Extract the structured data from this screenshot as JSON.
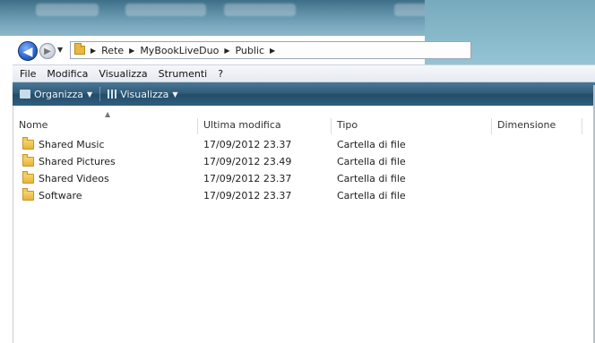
{
  "breadcrumb": [
    "Rete",
    "MyBookLiveDuo",
    "Public"
  ],
  "menu": [
    "File",
    "Modifica",
    "Visualizza",
    "Strumenti",
    "?"
  ],
  "toolbar": {
    "organize": "Organizza",
    "view": "Visualizza"
  },
  "columns": {
    "name": "Nome",
    "modified": "Ultima modifica",
    "type": "Tipo",
    "size": "Dimensione"
  },
  "files": [
    {
      "name": "Shared Music",
      "modified": "17/09/2012 23.37",
      "type": "Cartella di file"
    },
    {
      "name": "Shared Pictures",
      "modified": "17/09/2012 23.49",
      "type": "Cartella di file"
    },
    {
      "name": "Shared Videos",
      "modified": "17/09/2012 23.37",
      "type": "Cartella di file"
    },
    {
      "name": "Software",
      "modified": "17/09/2012 23.37",
      "type": "Cartella di file"
    }
  ],
  "icons": {
    "back": "back-arrow-icon",
    "forward": "forward-arrow-icon",
    "folder": "folder-icon",
    "organize": "organize-icon",
    "view": "view-grid-icon"
  }
}
